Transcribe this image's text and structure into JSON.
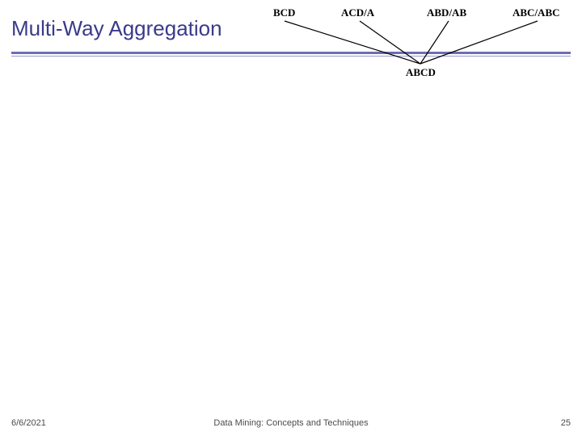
{
  "slide": {
    "title": "Multi-Way Aggregation"
  },
  "diagram": {
    "top_nodes": [
      "BCD",
      "ACD/A",
      "ABD/AB",
      "ABC/ABC"
    ],
    "bottom_node": "ABCD"
  },
  "footer": {
    "date": "6/6/2021",
    "center": "Data Mining: Concepts and Techniques",
    "page": "25"
  }
}
